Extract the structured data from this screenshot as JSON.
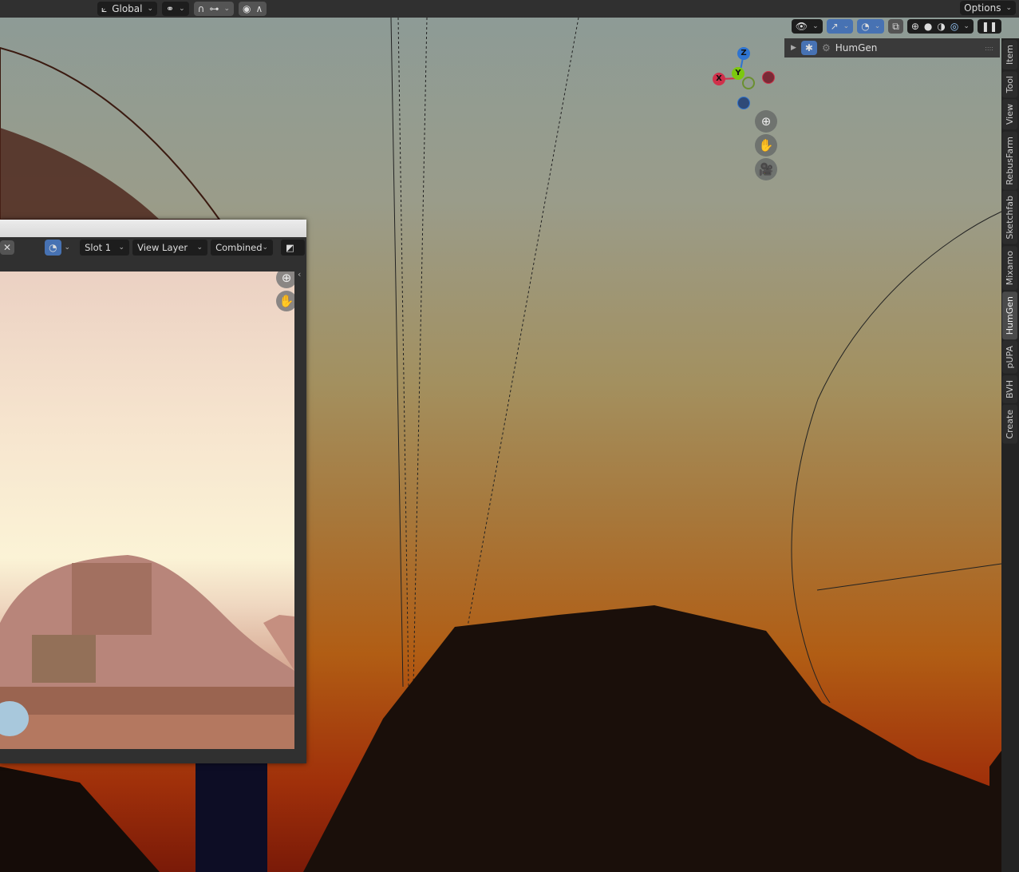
{
  "header": {
    "transform_orientation": "Global",
    "options_label": "Options"
  },
  "npanel": {
    "panel_title": "HumGen",
    "tabs": [
      "Item",
      "Tool",
      "View",
      "RebusFarm",
      "Sketchfab",
      "Mixamo",
      "HumGen",
      "pUPA",
      "BVH",
      "Create"
    ],
    "active_tab": "HumGen"
  },
  "gizmo": {
    "z": "Z",
    "y": "Y",
    "x": "X"
  },
  "image_editor": {
    "slot": "Slot 1",
    "view_layer": "View Layer",
    "pass": "Combined"
  },
  "colors": {
    "accent": "#4772b3",
    "x_axis": "#d0304a",
    "y_axis": "#7cc80e",
    "z_axis": "#2f74d0"
  }
}
